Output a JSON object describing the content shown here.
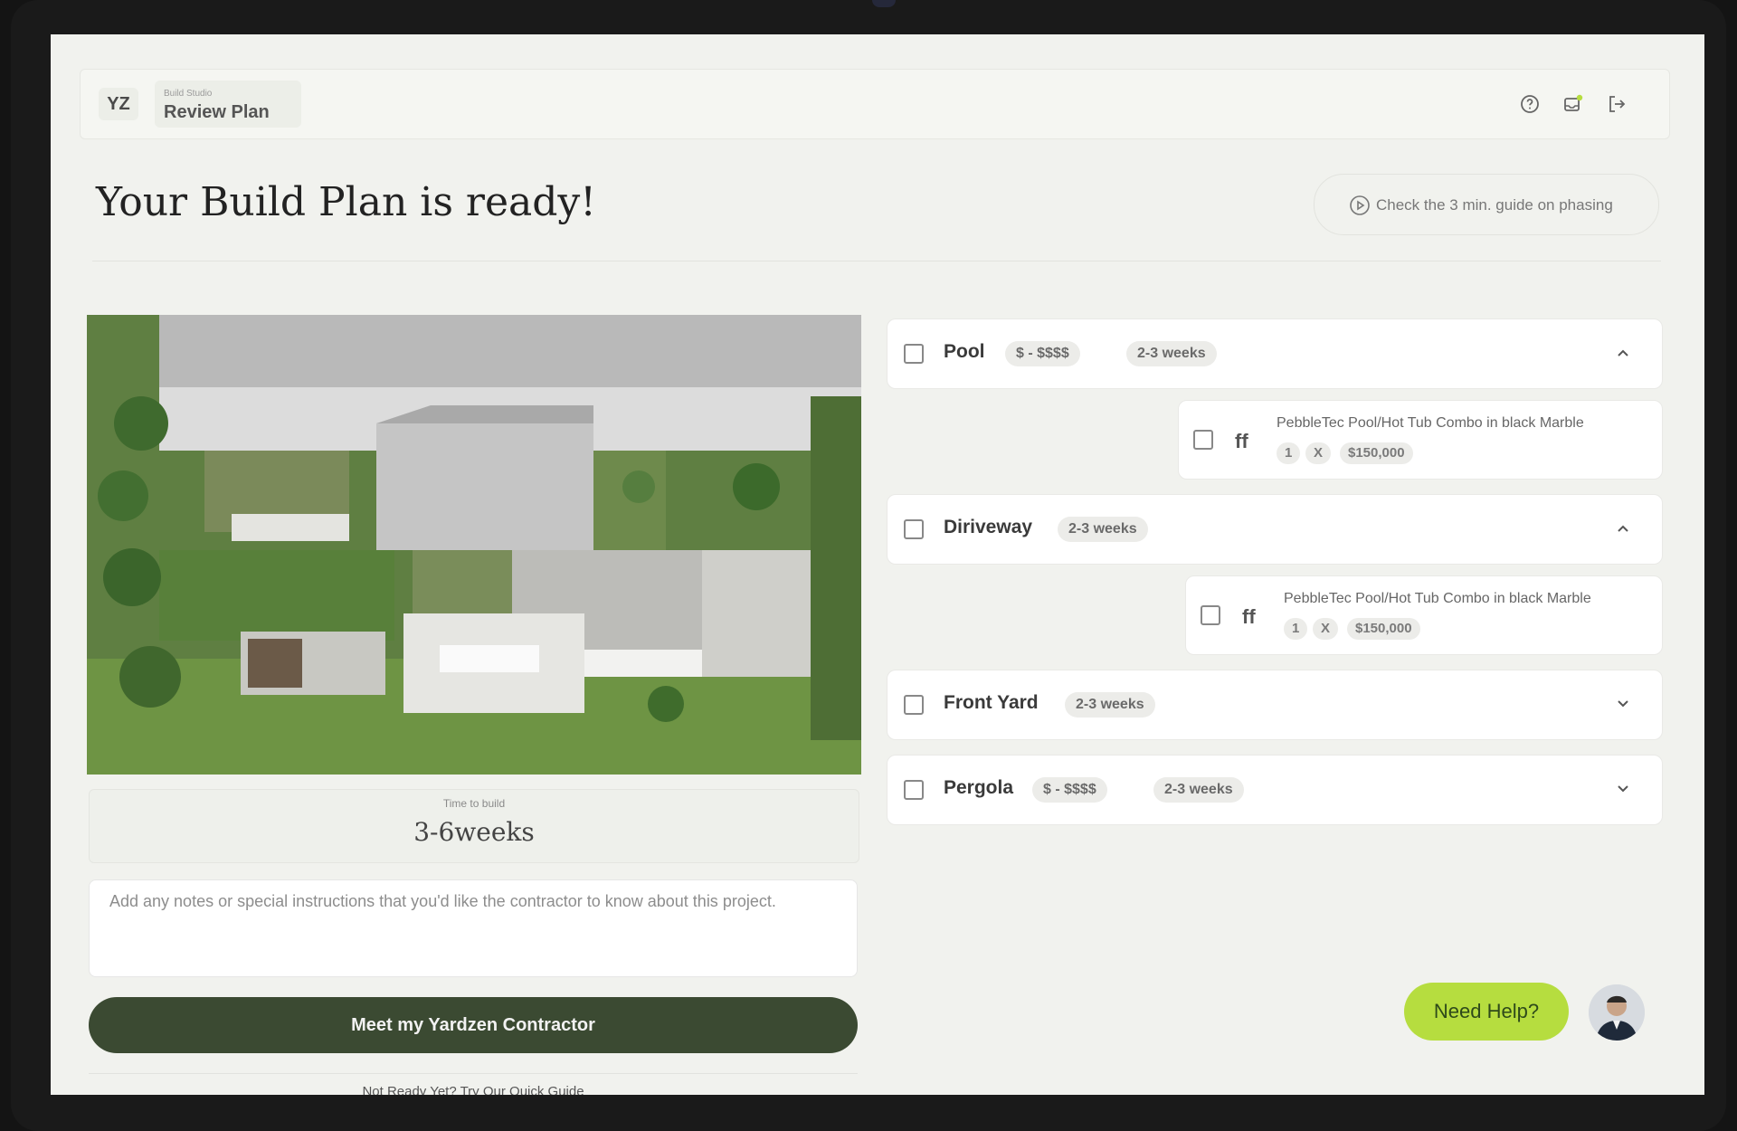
{
  "app": {
    "logo": "YZ",
    "crumb_small": "Build Studio",
    "crumb_title": "Review Plan"
  },
  "header": {
    "title": "Your Build Plan is ready!",
    "guide_link": "Check the 3 min. guide on phasing"
  },
  "summary": {
    "time_label": "Time to build",
    "time_value": "3-6weeks",
    "notes_placeholder": "Add any notes or special instructions that you'd like the contractor to know about this project.",
    "cta": "Meet my Yardzen Contractor",
    "partial_text": "Not Ready Yet? Try Our Quick Guide"
  },
  "categories": [
    {
      "name": "Pool",
      "price": "$ - $$$$",
      "duration": "2-3 weeks",
      "expanded": true
    },
    {
      "name": "Diriveway",
      "duration": "2-3 weeks",
      "expanded": true
    },
    {
      "name": "Front Yard",
      "duration": "2-3 weeks",
      "expanded": false
    },
    {
      "name": "Pergola",
      "price": "$ - $$$$",
      "duration": "2-3 weeks",
      "expanded": false
    }
  ],
  "items": [
    {
      "name": "PebbleTec Pool/Hot Tub Combo in black Marble",
      "icon": "ff",
      "qty": "1",
      "x": "X",
      "price": "$150,000"
    },
    {
      "name": "PebbleTec Pool/Hot Tub Combo in black Marble",
      "icon": "ff",
      "qty": "1",
      "x": "X",
      "price": "$150,000"
    }
  ],
  "help": {
    "label": "Need Help?"
  },
  "icons": [
    "help-circle-icon",
    "notification-icon",
    "logout-icon",
    "play-circle-icon",
    "chevron-up-icon",
    "chevron-down-icon",
    "pool-ladder-icon"
  ],
  "colors": {
    "accent": "#b6dd3f",
    "primary": "#3b4a32",
    "background": "#f1f2ee"
  }
}
